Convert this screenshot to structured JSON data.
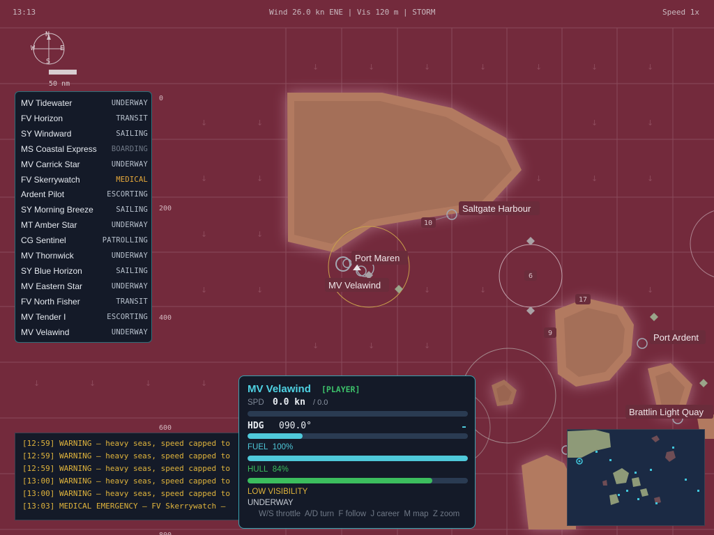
{
  "topbar": {
    "clock": "13:13",
    "weather": "Wind 26.0 kn ENE | Vis 120 m | STORM",
    "speed": "Speed 1x"
  },
  "compass": {
    "n": "N",
    "s": "S",
    "e": "E",
    "w": "W",
    "scale": "50 nm"
  },
  "map": {
    "grid_labels": [
      "0",
      "200",
      "400",
      "600",
      "800"
    ],
    "ports": [
      {
        "name": "Port Maren"
      },
      {
        "name": "Saltgate Harbour"
      },
      {
        "name": "Port Ardent"
      },
      {
        "name": "Brattlin Light Quay"
      }
    ],
    "player_ship_label": "MV Velawind",
    "depth_marks": [
      "10",
      "6",
      "17",
      "9"
    ]
  },
  "fleet": [
    {
      "name": "MV Tidewater",
      "status": "UNDERWAY",
      "color": "#b7c0cc"
    },
    {
      "name": "FV Horizon",
      "status": "TRANSIT",
      "color": "#b7c0cc"
    },
    {
      "name": "SY Windward",
      "status": "SAILING",
      "color": "#b7c0cc"
    },
    {
      "name": "MS Coastal Express",
      "status": "BOARDING",
      "color": "#6f7886"
    },
    {
      "name": "MV Carrick Star",
      "status": "UNDERWAY",
      "color": "#b7c0cc"
    },
    {
      "name": "FV Skerrywatch",
      "status": "MEDICAL",
      "color": "#e7a93a"
    },
    {
      "name": "Ardent Pilot",
      "status": "ESCORTING",
      "color": "#b7c0cc"
    },
    {
      "name": "SY Morning Breeze",
      "status": "SAILING",
      "color": "#b7c0cc"
    },
    {
      "name": "MT Amber Star",
      "status": "UNDERWAY",
      "color": "#b7c0cc"
    },
    {
      "name": "CG Sentinel",
      "status": "PATROLLING",
      "color": "#b7c0cc"
    },
    {
      "name": "MV Thornwick",
      "status": "UNDERWAY",
      "color": "#b7c0cc"
    },
    {
      "name": "SY Blue Horizon",
      "status": "SAILING",
      "color": "#b7c0cc"
    },
    {
      "name": "MV Eastern Star",
      "status": "UNDERWAY",
      "color": "#b7c0cc"
    },
    {
      "name": "FV North Fisher",
      "status": "TRANSIT",
      "color": "#b7c0cc"
    },
    {
      "name": "MV Tender I",
      "status": "ESCORTING",
      "color": "#b7c0cc"
    },
    {
      "name": "MV Velawind",
      "status": "UNDERWAY",
      "color": "#b7c0cc"
    }
  ],
  "log": [
    "[12:59] WARNING — heavy seas, speed capped to",
    "[12:59] WARNING — heavy seas, speed capped to",
    "[12:59] WARNING — heavy seas, speed capped to",
    "[13:00] WARNING — heavy seas, speed capped to",
    "[13:00] WARNING — heavy seas, speed capped to",
    "[13:03] MEDICAL EMERGENCY — FV Skerrywatch —"
  ],
  "ship_panel": {
    "name": "MV Velawind",
    "tag": "[PLAYER]",
    "spd_label": "SPD",
    "spd_value": "0.0 kn",
    "spd_max": "/ 0.0",
    "spd_fraction": 0.0,
    "hdg_label": "HDG",
    "hdg_value": "090.0°",
    "hdg_fraction": 0.25,
    "fuel_label": "FUEL",
    "fuel_value": "100%",
    "fuel_fraction": 1.0,
    "hull_label": "HULL",
    "hull_value": "84%",
    "hull_fraction": 0.84,
    "visibility": "LOW VISIBILITY",
    "status": "UNDERWAY",
    "help": "W/S throttle  A/D turn  F follow  J career  M map  Z zoom"
  },
  "colors": {
    "sea": "#732a3c",
    "land": "#a8705a",
    "accent": "#4fd2e3",
    "fuel": "#4fc9da",
    "hull": "#3cbe5e",
    "warning": "#e0b43c"
  }
}
